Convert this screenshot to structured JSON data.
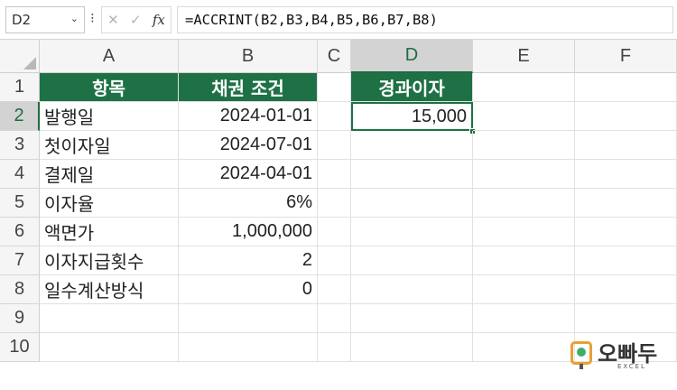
{
  "formula_bar": {
    "name_box": "D2",
    "fx_label": "fx",
    "formula": "=ACCRINT(B2,B3,B4,B5,B6,B7,B8)"
  },
  "columns": [
    "A",
    "B",
    "C",
    "D",
    "E",
    "F"
  ],
  "rows": [
    "1",
    "2",
    "3",
    "4",
    "5",
    "6",
    "7",
    "8",
    "9",
    "10"
  ],
  "selected_cell": "D2",
  "table": {
    "header_item": "항목",
    "header_condition": "채권 조건",
    "rows": [
      {
        "label": "발행일",
        "value": "2024-01-01"
      },
      {
        "label": "첫이자일",
        "value": "2024-07-01"
      },
      {
        "label": "결제일",
        "value": "2024-04-01"
      },
      {
        "label": "이자율",
        "value": "6%"
      },
      {
        "label": "액면가",
        "value": "1,000,000"
      },
      {
        "label": "이자지급횟수",
        "value": "2"
      },
      {
        "label": "일수계산방식",
        "value": "0"
      }
    ]
  },
  "result": {
    "header": "경과이자",
    "value": "15,000"
  },
  "logo": {
    "name": "오빠두",
    "sub": "EXCEL"
  },
  "colors": {
    "header_green": "#1e7145",
    "select_green": "#1e6b40"
  }
}
